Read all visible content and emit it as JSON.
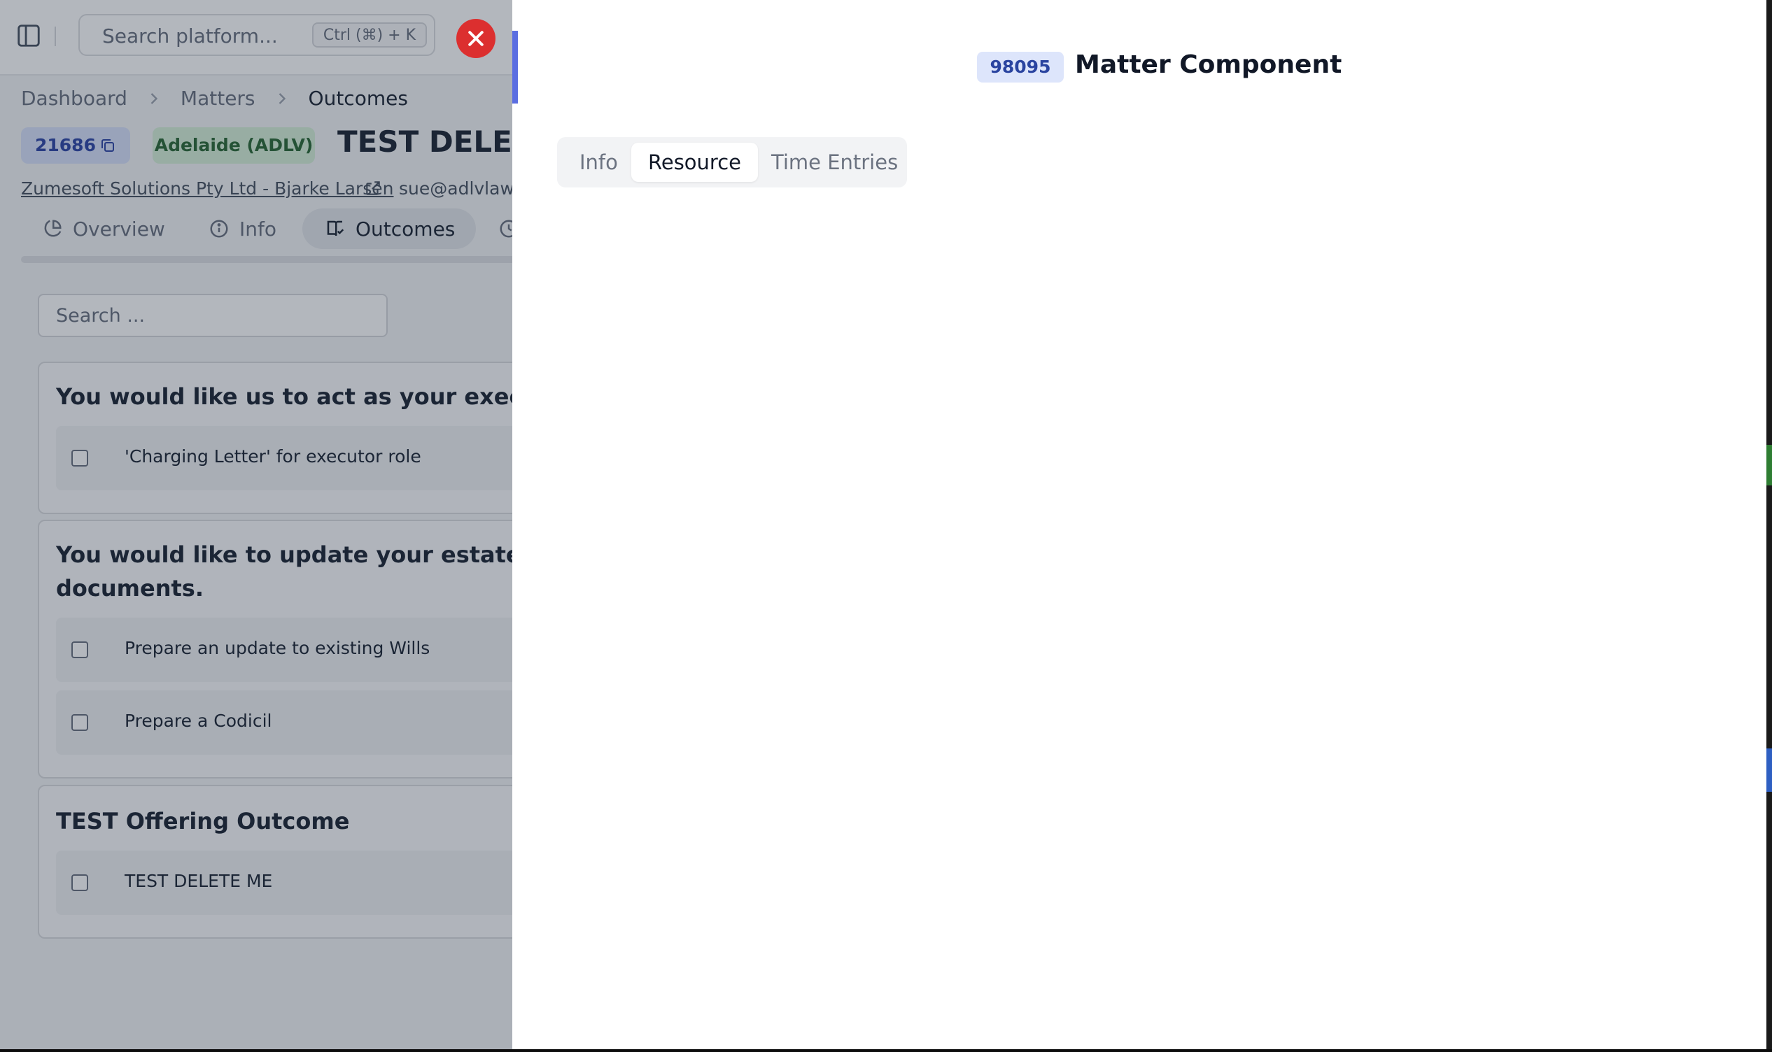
{
  "topbar": {
    "search_placeholder": "Search platform...",
    "search_shortcut": "Ctrl (⌘) + K"
  },
  "breadcrumb": [
    "Dashboard",
    "Matters",
    "Outcomes"
  ],
  "matter": {
    "id": "21686",
    "office": "Adelaide (ADLV)",
    "title": "TEST DELETE",
    "client": "Zumesoft Solutions Pty Ltd - Bjarke Larsen",
    "email": "sue@adlvlaw.c"
  },
  "tabs": {
    "overview": "Overview",
    "info": "Info",
    "outcomes": "Outcomes"
  },
  "outcomes": {
    "search_placeholder": "Search ...",
    "cards": [
      {
        "title": "You would like us to act as your executor a",
        "items": [
          "'Charging Letter' for executor role"
        ]
      },
      {
        "title_line1": "You would like to update your estate plann",
        "title_line2": "documents.",
        "items": [
          "Prepare an update to existing Wills",
          "Prepare a Codicil"
        ]
      },
      {
        "title": "TEST Offering Outcome",
        "items": [
          "TEST DELETE ME"
        ]
      }
    ]
  },
  "panel": {
    "id": "98095",
    "title": "Matter Component",
    "tabs": [
      "Info",
      "Resource",
      "Time Entries"
    ],
    "active_tab": "Resource"
  },
  "colors": {
    "close_button": "#dc2f2f",
    "accent": "#5b6ee1",
    "badge_blue": "#d9e2fb",
    "badge_green": "#d7f0d9"
  }
}
